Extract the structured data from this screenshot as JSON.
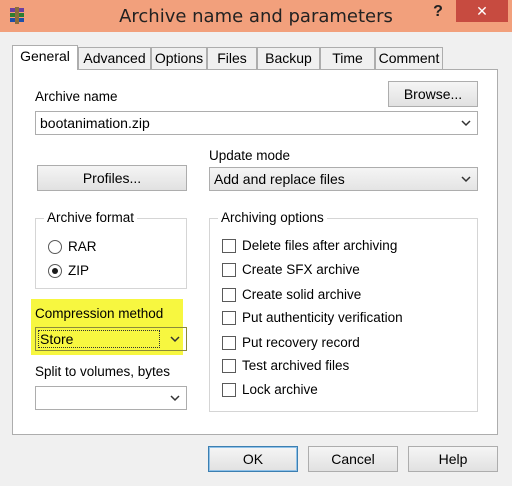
{
  "window": {
    "title": "Archive name and parameters",
    "help_glyph": "?",
    "close_glyph": "✕"
  },
  "tabs": [
    {
      "label": "General"
    },
    {
      "label": "Advanced"
    },
    {
      "label": "Options"
    },
    {
      "label": "Files"
    },
    {
      "label": "Backup"
    },
    {
      "label": "Time"
    },
    {
      "label": "Comment"
    }
  ],
  "archive_name": {
    "label": "Archive name",
    "value": "bootanimation.zip",
    "browse_label": "Browse..."
  },
  "profiles_label": "Profiles...",
  "update_mode": {
    "label": "Update mode",
    "value": "Add and replace files"
  },
  "archive_format": {
    "title": "Archive format",
    "options": [
      {
        "label": "RAR",
        "selected": false
      },
      {
        "label": "ZIP",
        "selected": true
      }
    ]
  },
  "compression_method": {
    "label": "Compression method",
    "value": "Store"
  },
  "split_volumes": {
    "label": "Split to volumes, bytes",
    "value": ""
  },
  "archiving_options": {
    "title": "Archiving options",
    "items": [
      {
        "label": "Delete files after archiving",
        "checked": false
      },
      {
        "label": "Create SFX archive",
        "checked": false
      },
      {
        "label": "Create solid archive",
        "checked": false
      },
      {
        "label": "Put authenticity verification",
        "checked": false
      },
      {
        "label": "Put recovery record",
        "checked": false
      },
      {
        "label": "Test archived files",
        "checked": false
      },
      {
        "label": "Lock archive",
        "checked": false
      }
    ]
  },
  "footer": {
    "ok_label": "OK",
    "cancel_label": "Cancel",
    "help_label": "Help"
  },
  "colors": {
    "titlebar": "#f2a07c",
    "close": "#c74b40",
    "highlight": "#f7f740"
  }
}
